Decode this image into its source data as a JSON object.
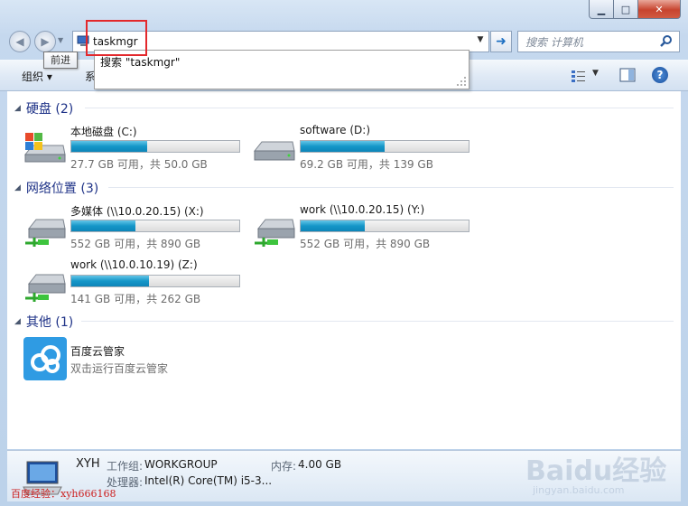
{
  "navigation": {
    "back_tooltip": "前进",
    "address_value": "taskmgr",
    "search_placeholder": "搜索 计算机",
    "autocomplete_item": "搜索 \"taskmgr\""
  },
  "toolbar": {
    "organize_label": "组织 ▾",
    "system_label": "系"
  },
  "groups": [
    {
      "title": "硬盘 (2)",
      "drives": [
        {
          "name": "本地磁盘 (C:)",
          "used_fraction": 0.45,
          "info": "27.7 GB 可用，共 50.0 GB",
          "icon": "windows-drive-icon"
        },
        {
          "name": "software (D:)",
          "used_fraction": 0.5,
          "info": "69.2 GB 可用，共 139 GB",
          "icon": "hard-drive-icon"
        }
      ]
    },
    {
      "title": "网络位置 (3)",
      "drives": [
        {
          "name": "多媒体 (\\\\10.0.20.15) (X:)",
          "used_fraction": 0.38,
          "info": "552 GB 可用，共 890 GB",
          "icon": "network-drive-icon"
        },
        {
          "name": "work (\\\\10.0.20.15) (Y:)",
          "used_fraction": 0.38,
          "info": "552 GB 可用，共 890 GB",
          "icon": "network-drive-icon"
        },
        {
          "name": "work (\\\\10.0.10.19) (Z:)",
          "used_fraction": 0.46,
          "info": "141 GB 可用，共 262 GB",
          "icon": "network-drive-icon"
        }
      ]
    },
    {
      "title": "其他 (1)",
      "items": [
        {
          "name": "百度云管家",
          "subtitle": "双击运行百度云管家",
          "icon": "baidu-cloud-icon"
        }
      ]
    }
  ],
  "details": {
    "computer_name": "XYH",
    "workgroup_label": "工作组:",
    "workgroup_value": "WORKGROUP",
    "memory_label": "内存:",
    "memory_value": "4.00 GB",
    "processor_label": "处理器:",
    "processor_value": "Intel(R) Core(TM) i5-3..."
  },
  "watermark": {
    "left_text": "百度经验：xyh666168",
    "right_text": "Baidu经验",
    "right_url": "jingyan.baidu.com"
  },
  "colors": {
    "accent": "#1e3287",
    "bar_fill": "#1596c8",
    "highlight": "#e3282c"
  }
}
